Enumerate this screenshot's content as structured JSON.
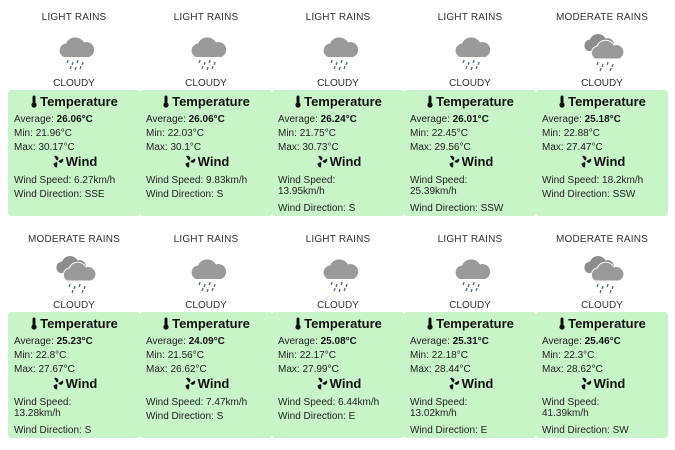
{
  "labels": {
    "temperature": "Temperature",
    "wind": "Wind",
    "average": "Average:",
    "min": "Min:",
    "max": "Max:",
    "wind_speed": "Wind Speed:",
    "wind_direction": "Wind Direction:"
  },
  "colors": {
    "panel": "#c8f5c8",
    "cloud": "#9a9a9a",
    "rain": "#5a6b86"
  },
  "cards": [
    {
      "title": "LIGHT RAINS",
      "icon": "light-rain-cloud-icon",
      "sky": "CLOUDY",
      "average": "26.06°C",
      "min": "21.96°C",
      "max": "30.17°C",
      "wind_speed": "6.27km/h",
      "wind_direction": "SSE"
    },
    {
      "title": "LIGHT RAINS",
      "icon": "light-rain-cloud-icon",
      "sky": "CLOUDY",
      "average": "26.06°C",
      "min": "22.03°C",
      "max": "30.1°C",
      "wind_speed": "9.83km/h",
      "wind_direction": "S"
    },
    {
      "title": "LIGHT RAINS",
      "icon": "light-rain-cloud-icon",
      "sky": "CLOUDY",
      "average": "26.24°C",
      "min": "21.75°C",
      "max": "30.73°C",
      "wind_speed": "13.95km/h",
      "wind_direction": "S"
    },
    {
      "title": "LIGHT RAINS",
      "icon": "light-rain-cloud-icon",
      "sky": "CLOUDY",
      "average": "26.01°C",
      "min": "22.45°C",
      "max": "29.56°C",
      "wind_speed": "25.39km/h",
      "wind_direction": "SSW"
    },
    {
      "title": "MODERATE RAINS",
      "icon": "moderate-rain-clouds-icon",
      "sky": "CLOUDY",
      "average": "25.18°C",
      "min": "22.88°C",
      "max": "27.47°C",
      "wind_speed": "18.2km/h",
      "wind_direction": "SSW"
    },
    {
      "title": "MODERATE RAINS",
      "icon": "moderate-rain-clouds-icon",
      "sky": "CLOUDY",
      "average": "25.23°C",
      "min": "22.8°C",
      "max": "27.67°C",
      "wind_speed": "13.28km/h",
      "wind_direction": "S"
    },
    {
      "title": "LIGHT RAINS",
      "icon": "light-rain-cloud-icon",
      "sky": "CLOUDY",
      "average": "24.09°C",
      "min": "21.56°C",
      "max": "26.62°C",
      "wind_speed": "7.47km/h",
      "wind_direction": "S"
    },
    {
      "title": "LIGHT RAINS",
      "icon": "light-rain-cloud-icon",
      "sky": "CLOUDY",
      "average": "25.08°C",
      "min": "22.17°C",
      "max": "27.99°C",
      "wind_speed": "6.44km/h",
      "wind_direction": "E"
    },
    {
      "title": "LIGHT RAINS",
      "icon": "light-rain-cloud-icon",
      "sky": "CLOUDY",
      "average": "25.31°C",
      "min": "22.18°C",
      "max": "28.44°C",
      "wind_speed": "13.02km/h",
      "wind_direction": "E"
    },
    {
      "title": "MODERATE RAINS",
      "icon": "moderate-rain-clouds-icon",
      "sky": "CLOUDY",
      "average": "25.46°C",
      "min": "22.3°C",
      "max": "28.62°C",
      "wind_speed": "41.39km/h",
      "wind_direction": "SW"
    }
  ]
}
